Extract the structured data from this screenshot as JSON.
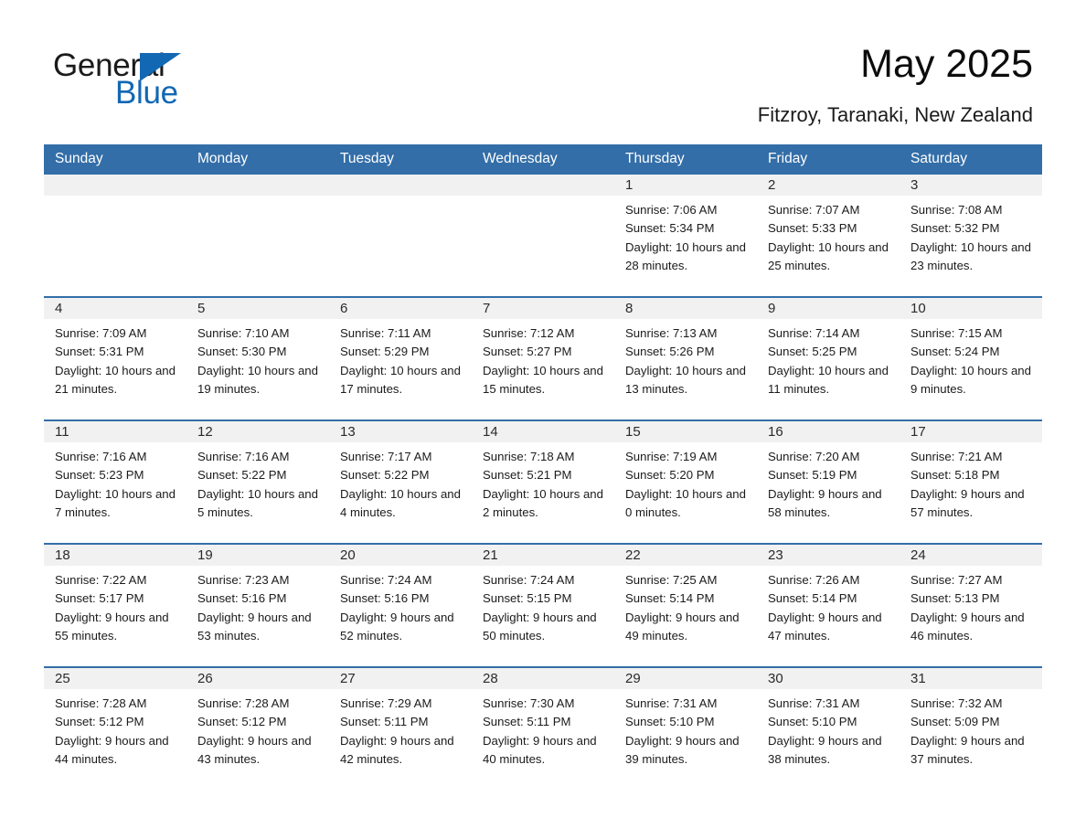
{
  "brand": {
    "name_part1": "General",
    "name_part2": "Blue",
    "accent_color": "#1268b3",
    "triangle_icon": "triangle-icon"
  },
  "header": {
    "month_title": "May 2025",
    "location": "Fitzroy, Taranaki, New Zealand"
  },
  "calendar": {
    "header_background": "#336ea8",
    "daynum_background": "#f1f1f1",
    "weekday_headers": [
      "Sunday",
      "Monday",
      "Tuesday",
      "Wednesday",
      "Thursday",
      "Friday",
      "Saturday"
    ],
    "weeks": [
      [
        {
          "day": "",
          "sunrise": "",
          "sunset": "",
          "daylight": "",
          "empty": true
        },
        {
          "day": "",
          "sunrise": "",
          "sunset": "",
          "daylight": "",
          "empty": true
        },
        {
          "day": "",
          "sunrise": "",
          "sunset": "",
          "daylight": "",
          "empty": true
        },
        {
          "day": "",
          "sunrise": "",
          "sunset": "",
          "daylight": "",
          "empty": true
        },
        {
          "day": "1",
          "sunrise": "Sunrise: 7:06 AM",
          "sunset": "Sunset: 5:34 PM",
          "daylight": "Daylight: 10 hours and 28 minutes.",
          "empty": false
        },
        {
          "day": "2",
          "sunrise": "Sunrise: 7:07 AM",
          "sunset": "Sunset: 5:33 PM",
          "daylight": "Daylight: 10 hours and 25 minutes.",
          "empty": false
        },
        {
          "day": "3",
          "sunrise": "Sunrise: 7:08 AM",
          "sunset": "Sunset: 5:32 PM",
          "daylight": "Daylight: 10 hours and 23 minutes.",
          "empty": false
        }
      ],
      [
        {
          "day": "4",
          "sunrise": "Sunrise: 7:09 AM",
          "sunset": "Sunset: 5:31 PM",
          "daylight": "Daylight: 10 hours and 21 minutes.",
          "empty": false
        },
        {
          "day": "5",
          "sunrise": "Sunrise: 7:10 AM",
          "sunset": "Sunset: 5:30 PM",
          "daylight": "Daylight: 10 hours and 19 minutes.",
          "empty": false
        },
        {
          "day": "6",
          "sunrise": "Sunrise: 7:11 AM",
          "sunset": "Sunset: 5:29 PM",
          "daylight": "Daylight: 10 hours and 17 minutes.",
          "empty": false
        },
        {
          "day": "7",
          "sunrise": "Sunrise: 7:12 AM",
          "sunset": "Sunset: 5:27 PM",
          "daylight": "Daylight: 10 hours and 15 minutes.",
          "empty": false
        },
        {
          "day": "8",
          "sunrise": "Sunrise: 7:13 AM",
          "sunset": "Sunset: 5:26 PM",
          "daylight": "Daylight: 10 hours and 13 minutes.",
          "empty": false
        },
        {
          "day": "9",
          "sunrise": "Sunrise: 7:14 AM",
          "sunset": "Sunset: 5:25 PM",
          "daylight": "Daylight: 10 hours and 11 minutes.",
          "empty": false
        },
        {
          "day": "10",
          "sunrise": "Sunrise: 7:15 AM",
          "sunset": "Sunset: 5:24 PM",
          "daylight": "Daylight: 10 hours and 9 minutes.",
          "empty": false
        }
      ],
      [
        {
          "day": "11",
          "sunrise": "Sunrise: 7:16 AM",
          "sunset": "Sunset: 5:23 PM",
          "daylight": "Daylight: 10 hours and 7 minutes.",
          "empty": false
        },
        {
          "day": "12",
          "sunrise": "Sunrise: 7:16 AM",
          "sunset": "Sunset: 5:22 PM",
          "daylight": "Daylight: 10 hours and 5 minutes.",
          "empty": false
        },
        {
          "day": "13",
          "sunrise": "Sunrise: 7:17 AM",
          "sunset": "Sunset: 5:22 PM",
          "daylight": "Daylight: 10 hours and 4 minutes.",
          "empty": false
        },
        {
          "day": "14",
          "sunrise": "Sunrise: 7:18 AM",
          "sunset": "Sunset: 5:21 PM",
          "daylight": "Daylight: 10 hours and 2 minutes.",
          "empty": false
        },
        {
          "day": "15",
          "sunrise": "Sunrise: 7:19 AM",
          "sunset": "Sunset: 5:20 PM",
          "daylight": "Daylight: 10 hours and 0 minutes.",
          "empty": false
        },
        {
          "day": "16",
          "sunrise": "Sunrise: 7:20 AM",
          "sunset": "Sunset: 5:19 PM",
          "daylight": "Daylight: 9 hours and 58 minutes.",
          "empty": false
        },
        {
          "day": "17",
          "sunrise": "Sunrise: 7:21 AM",
          "sunset": "Sunset: 5:18 PM",
          "daylight": "Daylight: 9 hours and 57 minutes.",
          "empty": false
        }
      ],
      [
        {
          "day": "18",
          "sunrise": "Sunrise: 7:22 AM",
          "sunset": "Sunset: 5:17 PM",
          "daylight": "Daylight: 9 hours and 55 minutes.",
          "empty": false
        },
        {
          "day": "19",
          "sunrise": "Sunrise: 7:23 AM",
          "sunset": "Sunset: 5:16 PM",
          "daylight": "Daylight: 9 hours and 53 minutes.",
          "empty": false
        },
        {
          "day": "20",
          "sunrise": "Sunrise: 7:24 AM",
          "sunset": "Sunset: 5:16 PM",
          "daylight": "Daylight: 9 hours and 52 minutes.",
          "empty": false
        },
        {
          "day": "21",
          "sunrise": "Sunrise: 7:24 AM",
          "sunset": "Sunset: 5:15 PM",
          "daylight": "Daylight: 9 hours and 50 minutes.",
          "empty": false
        },
        {
          "day": "22",
          "sunrise": "Sunrise: 7:25 AM",
          "sunset": "Sunset: 5:14 PM",
          "daylight": "Daylight: 9 hours and 49 minutes.",
          "empty": false
        },
        {
          "day": "23",
          "sunrise": "Sunrise: 7:26 AM",
          "sunset": "Sunset: 5:14 PM",
          "daylight": "Daylight: 9 hours and 47 minutes.",
          "empty": false
        },
        {
          "day": "24",
          "sunrise": "Sunrise: 7:27 AM",
          "sunset": "Sunset: 5:13 PM",
          "daylight": "Daylight: 9 hours and 46 minutes.",
          "empty": false
        }
      ],
      [
        {
          "day": "25",
          "sunrise": "Sunrise: 7:28 AM",
          "sunset": "Sunset: 5:12 PM",
          "daylight": "Daylight: 9 hours and 44 minutes.",
          "empty": false
        },
        {
          "day": "26",
          "sunrise": "Sunrise: 7:28 AM",
          "sunset": "Sunset: 5:12 PM",
          "daylight": "Daylight: 9 hours and 43 minutes.",
          "empty": false
        },
        {
          "day": "27",
          "sunrise": "Sunrise: 7:29 AM",
          "sunset": "Sunset: 5:11 PM",
          "daylight": "Daylight: 9 hours and 42 minutes.",
          "empty": false
        },
        {
          "day": "28",
          "sunrise": "Sunrise: 7:30 AM",
          "sunset": "Sunset: 5:11 PM",
          "daylight": "Daylight: 9 hours and 40 minutes.",
          "empty": false
        },
        {
          "day": "29",
          "sunrise": "Sunrise: 7:31 AM",
          "sunset": "Sunset: 5:10 PM",
          "daylight": "Daylight: 9 hours and 39 minutes.",
          "empty": false
        },
        {
          "day": "30",
          "sunrise": "Sunrise: 7:31 AM",
          "sunset": "Sunset: 5:10 PM",
          "daylight": "Daylight: 9 hours and 38 minutes.",
          "empty": false
        },
        {
          "day": "31",
          "sunrise": "Sunrise: 7:32 AM",
          "sunset": "Sunset: 5:09 PM",
          "daylight": "Daylight: 9 hours and 37 minutes.",
          "empty": false
        }
      ]
    ]
  }
}
